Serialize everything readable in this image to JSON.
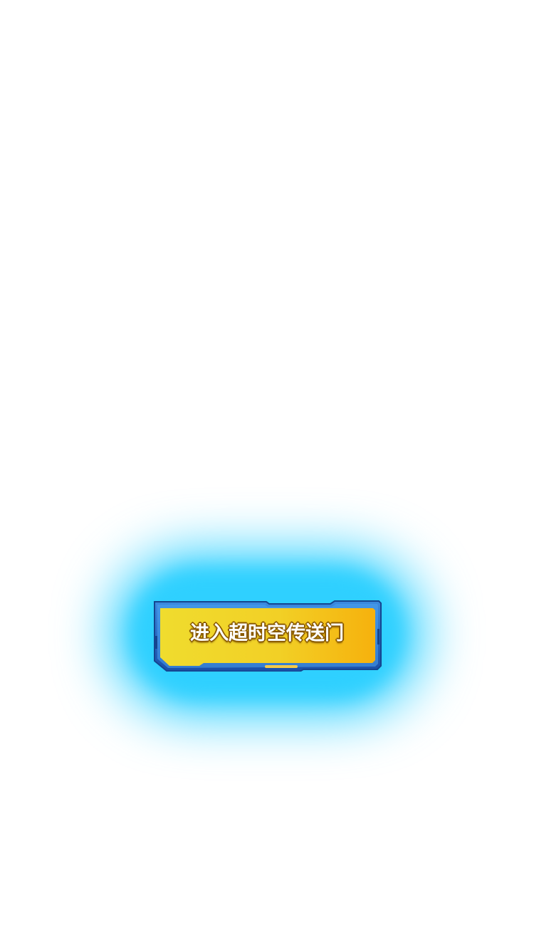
{
  "portal_button": {
    "label": "进入超时空传送门",
    "colors": {
      "glow": "#2fd0ff",
      "frame": "#1e63c4",
      "frame_dark": "#15458f",
      "fill_start": "#f2dc2c",
      "fill_end": "#f6b10d",
      "accent_bar": "#f3c94a"
    }
  }
}
